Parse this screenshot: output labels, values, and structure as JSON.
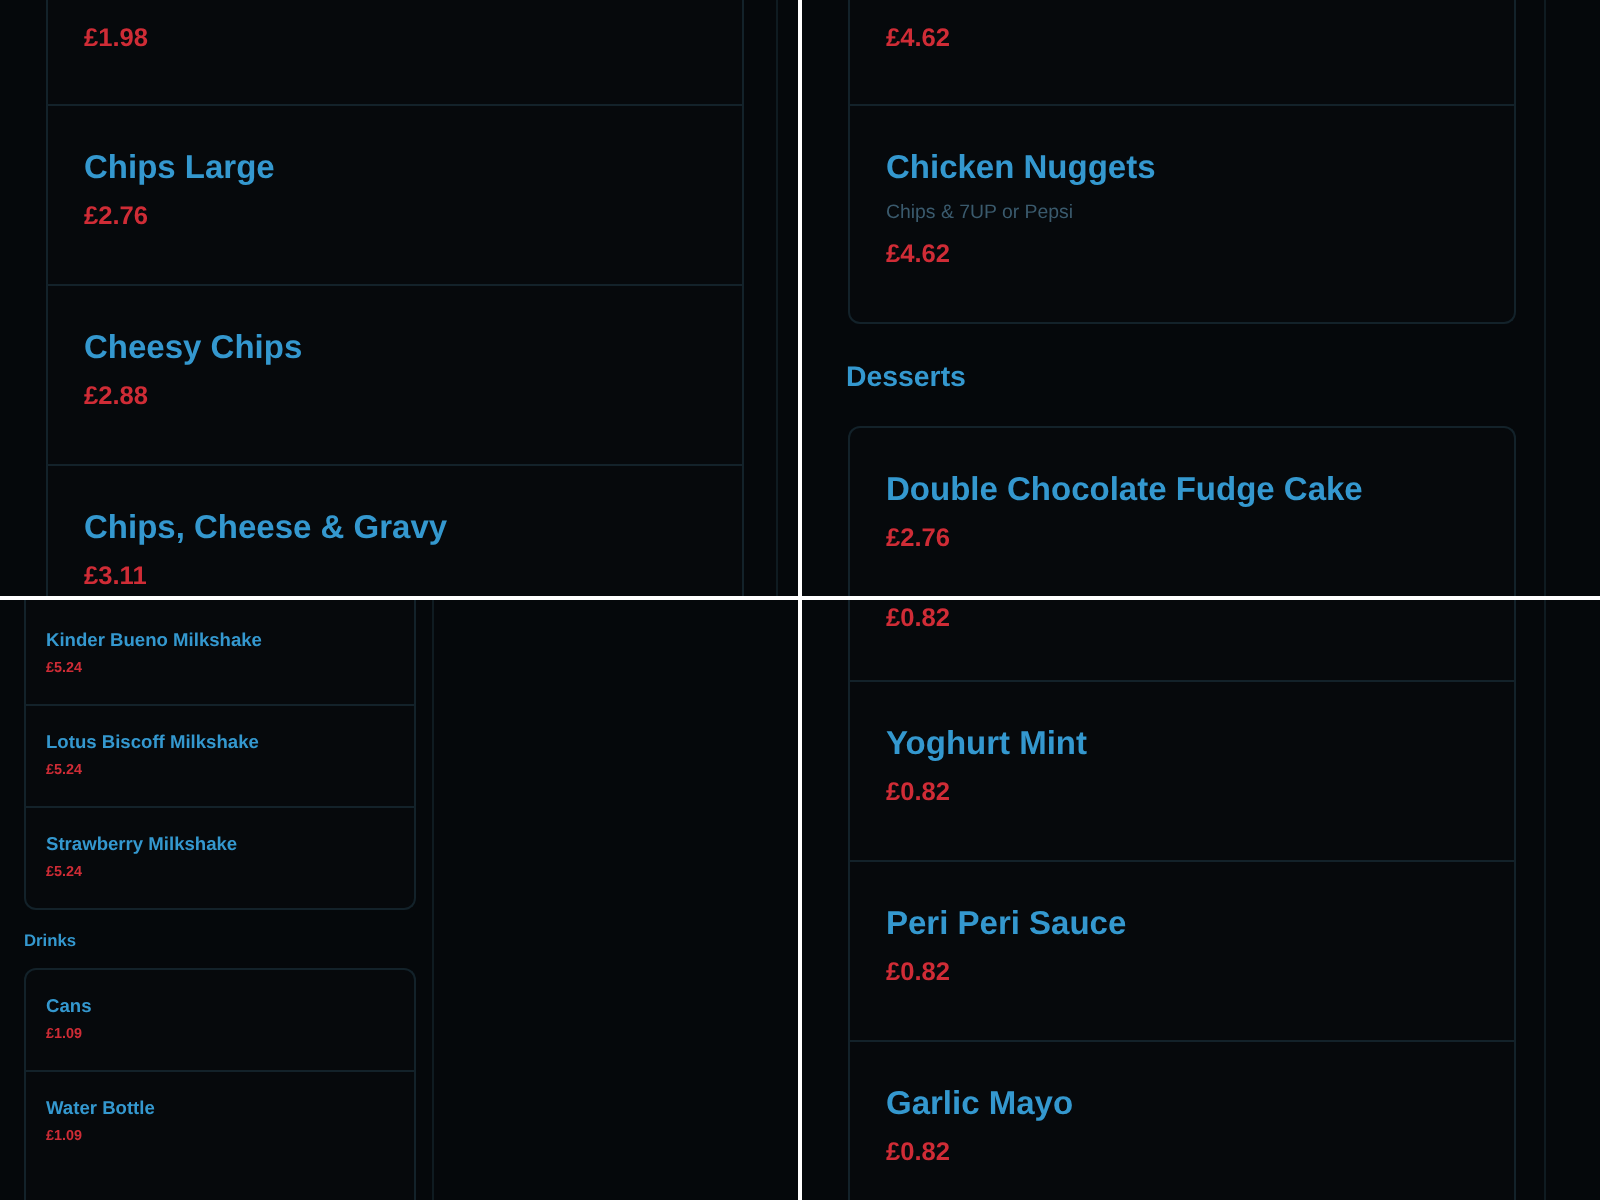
{
  "panels": [
    {
      "blocks": [
        {
          "kind": "card",
          "items": [
            {
              "price": "£1.98"
            },
            {
              "name": "Chips Large",
              "price": "£2.76"
            },
            {
              "name": "Cheesy Chips",
              "price": "£2.88"
            },
            {
              "name": "Chips, Cheese & Gravy",
              "price": "£3.11"
            }
          ]
        }
      ]
    },
    {
      "blocks": [
        {
          "kind": "card",
          "items": [
            {
              "price": "£4.62"
            },
            {
              "name": "Chicken Nuggets",
              "description": "Chips & 7UP or Pepsi",
              "price": "£4.62"
            }
          ]
        },
        {
          "kind": "heading",
          "text": "Desserts"
        },
        {
          "kind": "card",
          "items": [
            {
              "name": "Double Chocolate Fudge Cake",
              "price": "£2.76"
            }
          ]
        }
      ]
    },
    {
      "blocks": [
        {
          "kind": "card",
          "items": [
            {
              "name": "Kinder Bueno Milkshake",
              "price": "£5.24"
            },
            {
              "name": "Lotus Biscoff Milkshake",
              "price": "£5.24"
            },
            {
              "name": "Strawberry Milkshake",
              "price": "£5.24"
            }
          ]
        },
        {
          "kind": "heading",
          "text": "Drinks"
        },
        {
          "kind": "card",
          "items": [
            {
              "name": "Cans",
              "price": "£1.09"
            },
            {
              "name": "Water Bottle",
              "price": "£1.09"
            }
          ]
        }
      ]
    },
    {
      "blocks": [
        {
          "kind": "card",
          "items": [
            {
              "price": "£0.82"
            },
            {
              "name": "Yoghurt Mint",
              "price": "£0.82"
            },
            {
              "name": "Peri Peri Sauce",
              "price": "£0.82"
            },
            {
              "name": "Garlic Mayo",
              "price": "£0.82"
            }
          ]
        }
      ]
    }
  ]
}
